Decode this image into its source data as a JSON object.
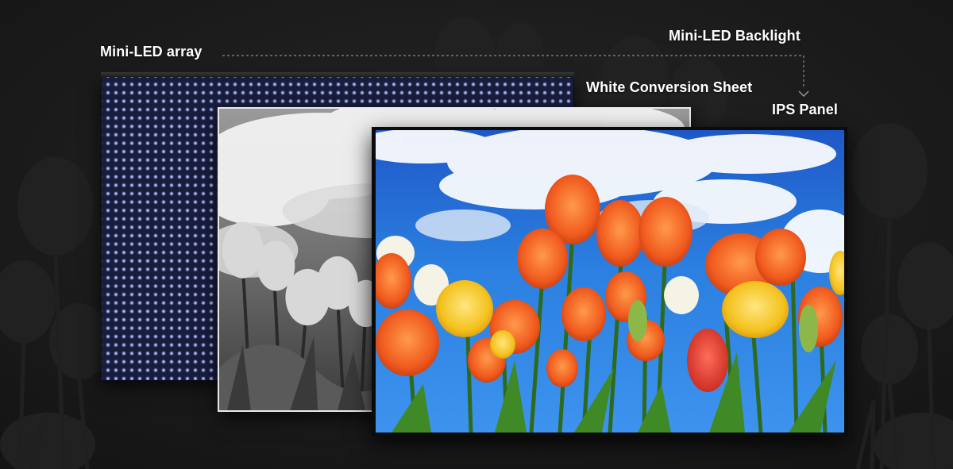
{
  "labels": {
    "mini_led_array": "Mini-LED array",
    "mini_led_backlight": "Mini-LED Backlight",
    "white_conversion_sheet": "White Conversion Sheet",
    "ips_panel": "IPS Panel"
  },
  "colors": {
    "background": "#1b1b1b",
    "label_text": "#ffffff",
    "leader_line": "#8a8a8a",
    "led_array_base": "#181d3c",
    "led_dot": "#b8c0ee",
    "sky_blue": "#1f6fd6",
    "tulip_orange": "#f05a1e",
    "tulip_yellow": "#f4c21f",
    "stem_green": "#2e6a1e"
  }
}
